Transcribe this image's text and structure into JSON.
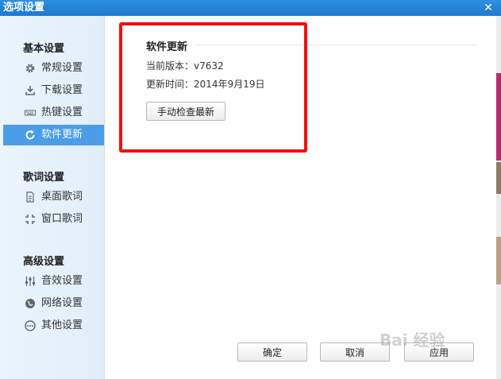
{
  "window": {
    "title": "选项设置",
    "close_symbol": "✕"
  },
  "sidebar": {
    "sections": [
      {
        "title": "基本设置",
        "items": [
          {
            "label": "常规设置",
            "icon": "gear-icon"
          },
          {
            "label": "下载设置",
            "icon": "download-icon"
          },
          {
            "label": "热键设置",
            "icon": "keyboard-icon"
          },
          {
            "label": "软件更新",
            "icon": "refresh-icon",
            "active": true
          }
        ]
      },
      {
        "title": "歌词设置",
        "items": [
          {
            "label": "桌面歌词",
            "icon": "desktop-lyrics-icon"
          },
          {
            "label": "窗口歌词",
            "icon": "window-lyrics-icon"
          }
        ]
      },
      {
        "title": "高级设置",
        "items": [
          {
            "label": "音效设置",
            "icon": "equalizer-icon"
          },
          {
            "label": "网络设置",
            "icon": "network-icon"
          },
          {
            "label": "其他设置",
            "icon": "more-icon"
          }
        ]
      }
    ]
  },
  "update": {
    "title": "软件更新",
    "version_label": "当前版本：",
    "version_value": "v7632",
    "time_label": "更新时间：",
    "time_value": "2014年9月19日",
    "check_button": "手动检查最新"
  },
  "footer": {
    "ok": "确定",
    "cancel": "取消",
    "apply": "应用"
  },
  "watermark": "Bai 经验",
  "colors": {
    "titlebar": "#1d79cf",
    "active_item": "#4a9de6",
    "highlight_border": "#ee1111"
  }
}
